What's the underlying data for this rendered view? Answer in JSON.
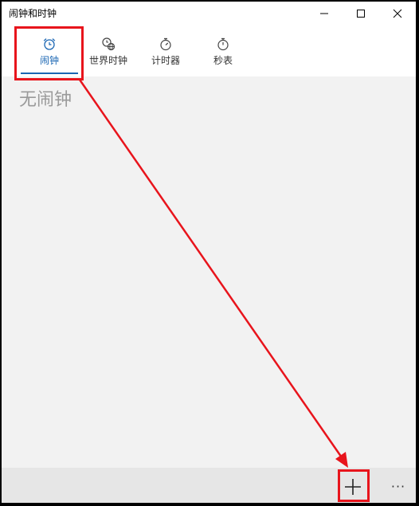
{
  "window": {
    "title": "闹钟和时钟",
    "controls": [
      "minimize-icon",
      "maximize-icon",
      "close-icon"
    ]
  },
  "tabs": [
    {
      "label": "闹钟",
      "icon": "alarm-clock-icon",
      "active": true
    },
    {
      "label": "世界时钟",
      "icon": "world-clock-icon",
      "active": false
    },
    {
      "label": "计时器",
      "icon": "timer-icon",
      "active": false
    },
    {
      "label": "秒表",
      "icon": "stopwatch-icon",
      "active": false
    }
  ],
  "main": {
    "empty_message": "无闹钟"
  },
  "command_bar": {
    "add_icon": "plus-icon",
    "more_label": "···"
  },
  "colors": {
    "accent": "#1a66b3",
    "annotation": "#e8141c",
    "content_bg": "#f2f2f2",
    "command_bar_bg": "#e6e6e6"
  }
}
